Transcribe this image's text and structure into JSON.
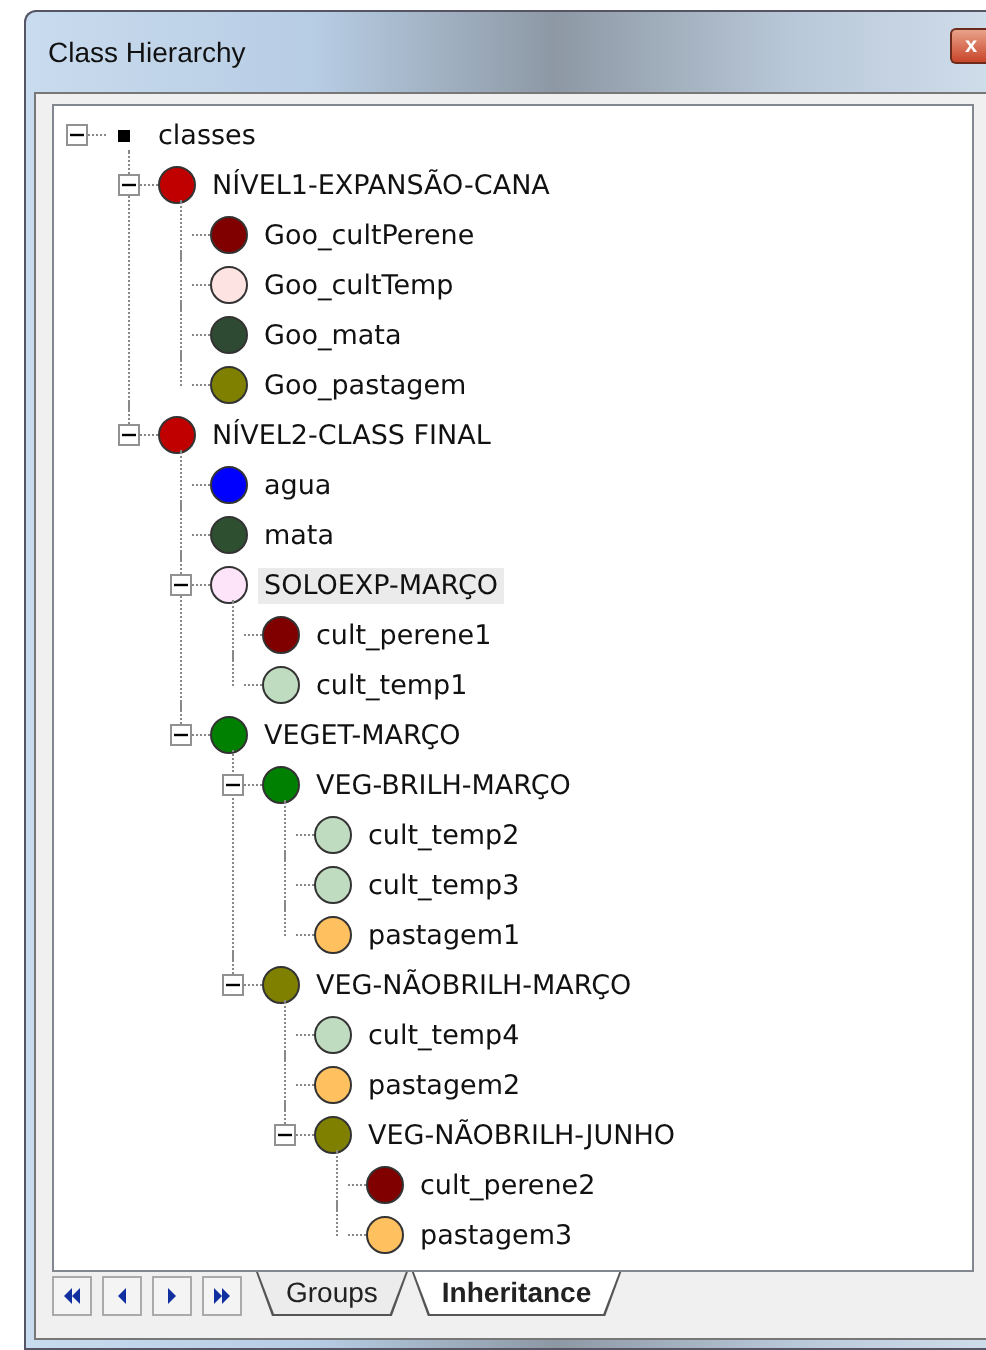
{
  "window": {
    "title": "Class Hierarchy",
    "close": "x"
  },
  "tree": {
    "label": "classes",
    "expanded": true,
    "selected": false,
    "children": [
      {
        "label": "NÍVEL1-EXPANSÃO-CANA",
        "color": "#c00000",
        "expanded": true,
        "selected": false,
        "children": [
          {
            "label": "Goo_cultPerene",
            "color": "#800000",
            "selected": false
          },
          {
            "label": "Goo_cultTemp",
            "color": "#fde4e2",
            "selected": false
          },
          {
            "label": "Goo_mata",
            "color": "#2f4a32",
            "selected": false
          },
          {
            "label": "Goo_pastagem",
            "color": "#808000",
            "selected": false
          }
        ]
      },
      {
        "label": "NÍVEL2-CLASS FINAL",
        "color": "#c00000",
        "expanded": true,
        "selected": false,
        "children": [
          {
            "label": "agua",
            "color": "#0000ff",
            "selected": false
          },
          {
            "label": "mata",
            "color": "#2f5030",
            "selected": false
          },
          {
            "label": "SOLOEXP-MARÇO",
            "color": "#fde4f8",
            "expanded": true,
            "selected": true,
            "children": [
              {
                "label": "cult_perene1",
                "color": "#800000",
                "selected": false
              },
              {
                "label": "cult_temp1",
                "color": "#c0dcc0",
                "selected": false
              }
            ]
          },
          {
            "label": "VEGET-MARÇO",
            "color": "#008000",
            "expanded": true,
            "selected": false,
            "children": [
              {
                "label": "VEG-BRILH-MARÇO",
                "color": "#008000",
                "expanded": true,
                "selected": false,
                "children": [
                  {
                    "label": "cult_temp2",
                    "color": "#c0dcc0",
                    "selected": false
                  },
                  {
                    "label": "cult_temp3",
                    "color": "#c0dcc0",
                    "selected": false
                  },
                  {
                    "label": "pastagem1",
                    "color": "#ffc060",
                    "selected": false
                  }
                ]
              },
              {
                "label": "VEG-NÃOBRILH-MARÇO",
                "color": "#808000",
                "expanded": true,
                "selected": false,
                "children": [
                  {
                    "label": "cult_temp4",
                    "color": "#c0dcc0",
                    "selected": false
                  },
                  {
                    "label": "pastagem2",
                    "color": "#ffc060",
                    "selected": false
                  },
                  {
                    "label": "VEG-NÃOBRILH-JUNHO",
                    "color": "#808000",
                    "expanded": true,
                    "selected": false,
                    "children": [
                      {
                        "label": "cult_perene2",
                        "color": "#800000",
                        "selected": false
                      },
                      {
                        "label": "pastagem3",
                        "color": "#ffc060",
                        "selected": false
                      }
                    ]
                  }
                ]
              }
            ]
          }
        ]
      }
    ]
  },
  "tabs": [
    {
      "label": "Groups",
      "selected": false
    },
    {
      "label": "Inheritance",
      "selected": true
    }
  ]
}
